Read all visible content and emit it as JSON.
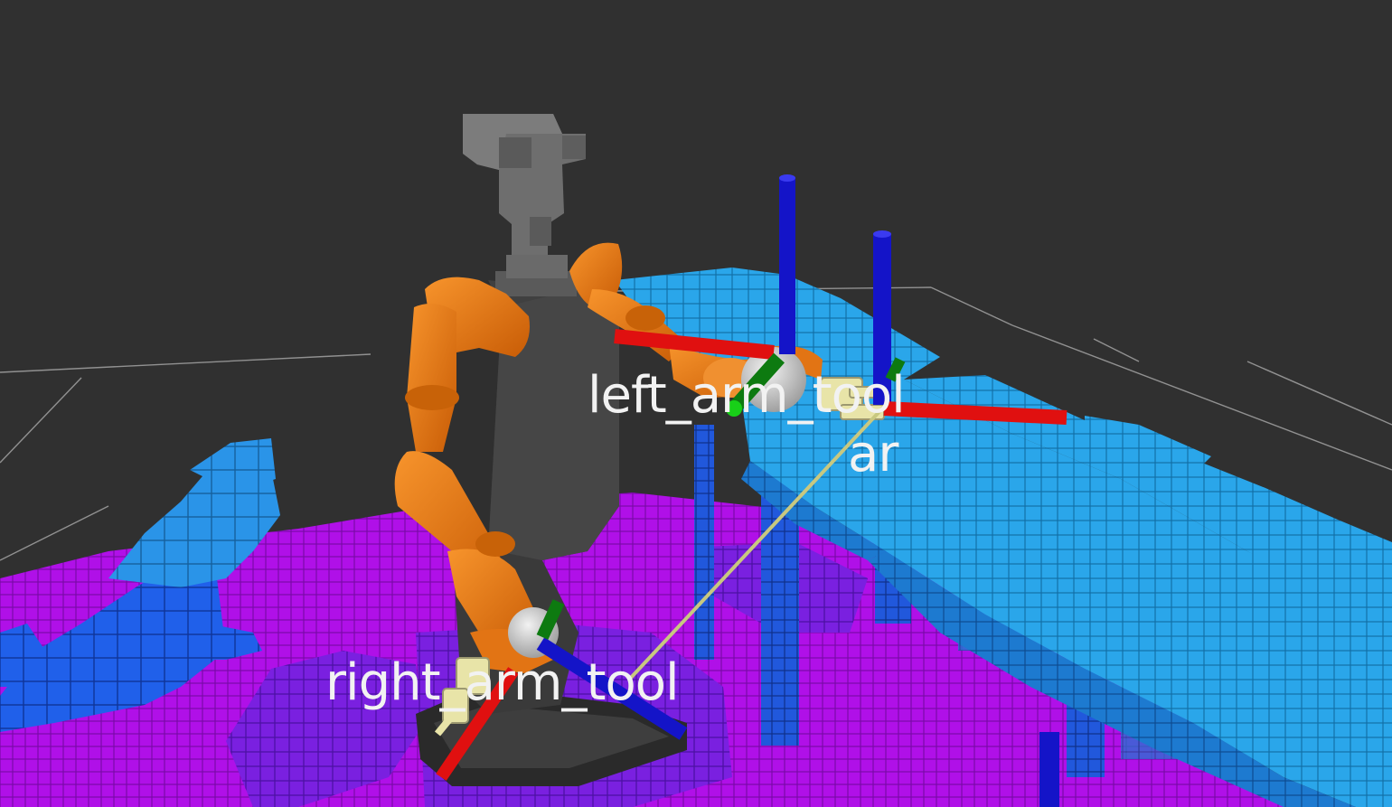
{
  "viewer": {
    "background_color": "#303030",
    "grid_color": "#a0a0a0"
  },
  "robot": {
    "arm_color": "#ef7a14",
    "body_color": "#3c3c3c",
    "head_color": "#6e6e6e",
    "gripper_color": "#e8e4a8"
  },
  "axes_colors": {
    "x": "#e01010",
    "y": "#0d7a10",
    "z": "#1414c8"
  },
  "voxels": {
    "floor_color": "#b010e8",
    "table_color": "#27a0e8",
    "obstacle_color": "#1e50e6"
  },
  "labels": {
    "left_arm_tool": "left_arm_tool",
    "ar": "ar",
    "right_arm_tool": "right_arm_tool"
  }
}
